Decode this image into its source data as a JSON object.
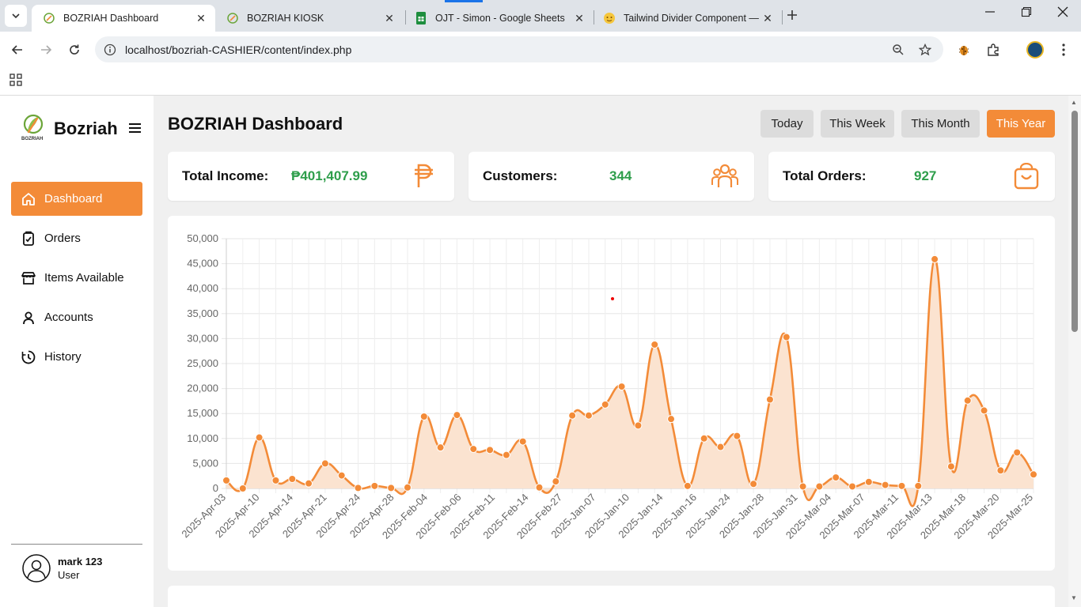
{
  "browser": {
    "tabs": [
      {
        "title": "BOZRIAH Dashboard",
        "active": true
      },
      {
        "title": "BOZRIAH KIOSK",
        "active": false
      },
      {
        "title": "OJT - Simon - Google Sheets",
        "active": false
      },
      {
        "title": "Tailwind Divider Component —",
        "active": false
      }
    ],
    "url": "localhost/bozriah-CASHIER/content/index.php"
  },
  "sidebar": {
    "brand": "Bozriah",
    "logo_text": "BOZRIAH",
    "items": [
      {
        "label": "Dashboard",
        "icon": "home-icon",
        "active": true
      },
      {
        "label": "Orders",
        "icon": "clipboard-icon",
        "active": false
      },
      {
        "label": "Items Available",
        "icon": "store-icon",
        "active": false
      },
      {
        "label": "Accounts",
        "icon": "user-icon",
        "active": false
      },
      {
        "label": "History",
        "icon": "history-icon",
        "active": false
      }
    ],
    "user": {
      "name": "mark 123",
      "role": "User"
    }
  },
  "main": {
    "title": "BOZRIAH Dashboard",
    "ranges": [
      "Today",
      "This Week",
      "This Month",
      "This Year"
    ],
    "active_range": "This Year",
    "cards": [
      {
        "label": "Total Income:",
        "value": "₱401,407.99",
        "icon": "peso-icon"
      },
      {
        "label": "Customers:",
        "value": "344",
        "icon": "users-icon"
      },
      {
        "label": "Total Orders:",
        "value": "927",
        "icon": "shopping-bag-icon"
      }
    ]
  },
  "colors": {
    "accent": "#f38b38",
    "value_green": "#2e9e4b",
    "fill": "#fbe3d0"
  },
  "chart_data": {
    "type": "area",
    "ylim": [
      0,
      50000
    ],
    "y_ticks": [
      "0",
      "5,000",
      "10,000",
      "15,000",
      "20,000",
      "25,000",
      "30,000",
      "35,000",
      "40,000",
      "45,000",
      "50,000"
    ],
    "x_tick_labels": [
      "2025-Apr-03",
      "2025-Apr-10",
      "2025-Apr-14",
      "2025-Apr-21",
      "2025-Apr-24",
      "2025-Apr-28",
      "2025-Feb-04",
      "2025-Feb-06",
      "2025-Feb-11",
      "2025-Feb-14",
      "2025-Feb-27",
      "2025-Jan-07",
      "2025-Jan-10",
      "2025-Jan-14",
      "2025-Jan-16",
      "2025-Jan-24",
      "2025-Jan-28",
      "2025-Jan-31",
      "2025-Mar-04",
      "2025-Mar-07",
      "2025-Mar-11",
      "2025-Mar-13",
      "2025-Mar-18",
      "2025-Mar-20",
      "2025-Mar-25"
    ],
    "values": [
      1600,
      0,
      10200,
      1600,
      1900,
      1000,
      5000,
      2600,
      100,
      500,
      100,
      200,
      14400,
      8200,
      14700,
      7900,
      7700,
      6700,
      9400,
      200,
      1400,
      14600,
      14600,
      16800,
      20400,
      12600,
      28800,
      13900,
      500,
      10000,
      8300,
      10500,
      900,
      17800,
      30300,
      400,
      400,
      2200,
      400,
      1300,
      700,
      500,
      500,
      45900,
      4400,
      17600,
      15600,
      3600,
      7200,
      2800
    ]
  }
}
